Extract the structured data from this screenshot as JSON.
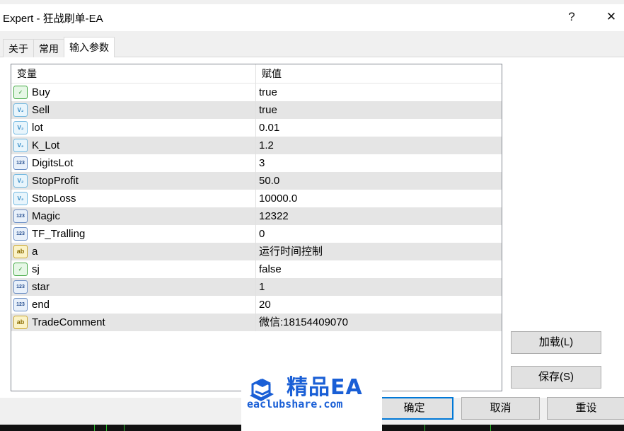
{
  "window": {
    "title": "Expert - 狂战刷单-EA",
    "help_label": "?",
    "close_label": "✕"
  },
  "tabs": [
    {
      "label": "关于",
      "active": false
    },
    {
      "label": "常用",
      "active": false
    },
    {
      "label": "输入参数",
      "active": true
    }
  ],
  "table": {
    "headers": [
      "变量",
      "赋值"
    ],
    "rows": [
      {
        "icon": "bool-icon",
        "name": "Buy",
        "value": "true"
      },
      {
        "icon": "double-icon",
        "name": "Sell",
        "value": "true"
      },
      {
        "icon": "double-icon",
        "name": "lot",
        "value": "0.01"
      },
      {
        "icon": "double-icon",
        "name": "K_Lot",
        "value": "1.2"
      },
      {
        "icon": "int-icon",
        "name": "DigitsLot",
        "value": "3"
      },
      {
        "icon": "double-icon",
        "name": "StopProfit",
        "value": "50.0"
      },
      {
        "icon": "double-icon",
        "name": "StopLoss",
        "value": "10000.0"
      },
      {
        "icon": "int-icon",
        "name": "Magic",
        "value": "12322"
      },
      {
        "icon": "int-icon",
        "name": "TF_Tralling",
        "value": "0"
      },
      {
        "icon": "string-icon",
        "name": "a",
        "value": "运行时间控制"
      },
      {
        "icon": "bool-icon",
        "name": "sj",
        "value": "false"
      },
      {
        "icon": "int-icon",
        "name": "star",
        "value": "1"
      },
      {
        "icon": "int-icon",
        "name": "end",
        "value": "20"
      },
      {
        "icon": "string-icon",
        "name": "TradeComment",
        "value": "微信:18154409070"
      }
    ]
  },
  "buttons": {
    "load": "加载(L)",
    "save": "保存(S)",
    "ok": "确定",
    "cancel": "取消",
    "reset": "重设"
  },
  "watermark": {
    "title": "精品EA",
    "url": "eaclubshare.com"
  },
  "icon_glyphs": {
    "bool-icon": "✓",
    "double-icon": "V₂",
    "int-icon": "123",
    "string-icon": "ab"
  }
}
